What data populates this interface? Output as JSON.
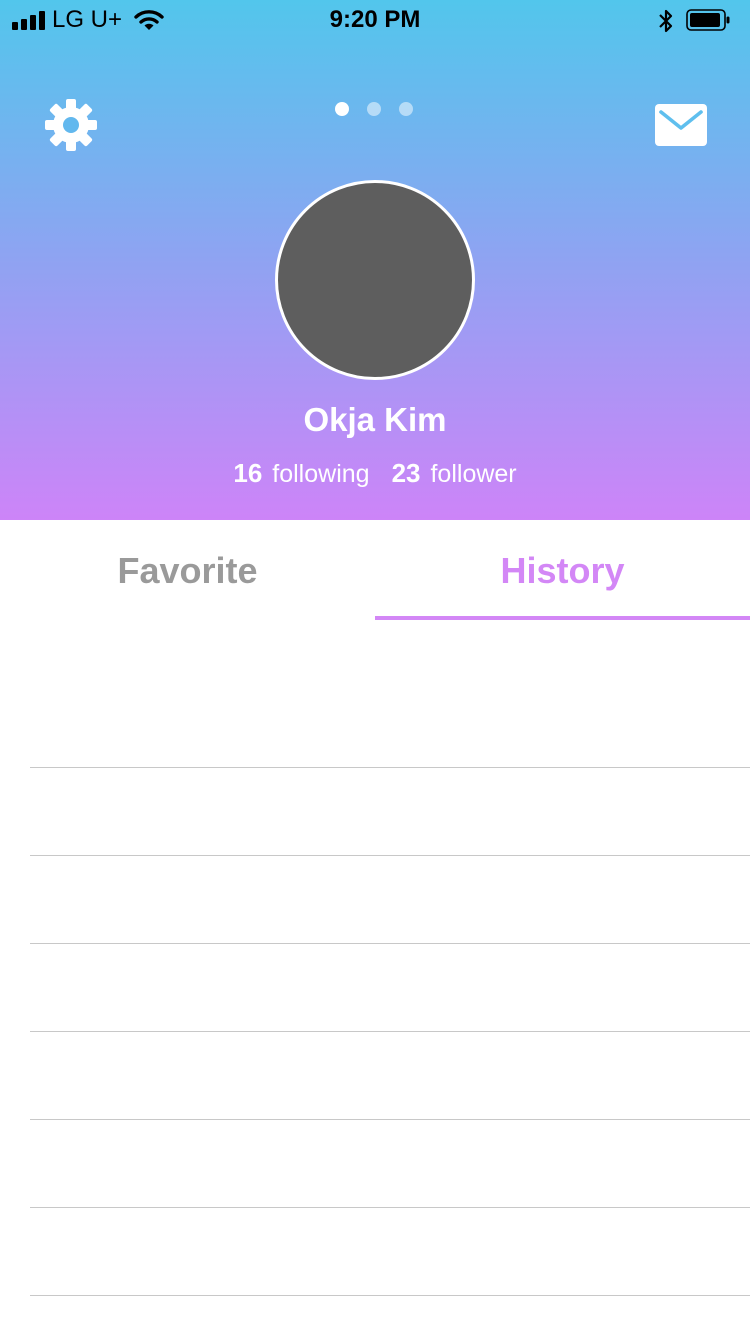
{
  "status_bar": {
    "carrier": "LG U+",
    "time": "9:20 PM"
  },
  "profile": {
    "name": "Okja Kim",
    "following_count": "16",
    "following_label": "following",
    "follower_count": "23",
    "follower_label": "follower"
  },
  "pager": {
    "page_count": 3,
    "active_page": 1
  },
  "tabs": {
    "favorite_label": "Favorite",
    "history_label": "History",
    "active": "History"
  },
  "history_list": {
    "row_count": 7
  },
  "colors": {
    "gradient_top": "#52c6ec",
    "gradient_bottom": "#cd84f8",
    "accent": "#d387f6",
    "inactive_tab": "#9a9a9a",
    "avatar_fill": "#5e5e5e",
    "divider": "#c8c8c8"
  },
  "icons": {
    "settings": "gear-icon",
    "messages": "mail-icon",
    "wifi": "wifi-icon",
    "bluetooth": "bluetooth-icon",
    "battery": "battery-icon"
  }
}
